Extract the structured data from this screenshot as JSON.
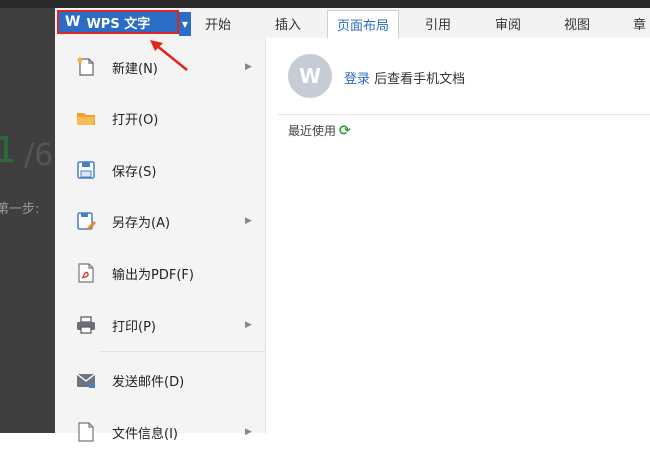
{
  "app_button": {
    "logo": "W",
    "label": "WPS 文字",
    "caret": "▼"
  },
  "tabs": [
    {
      "label": "开始"
    },
    {
      "label": "插入"
    },
    {
      "label": "页面布局"
    },
    {
      "label": "引用"
    },
    {
      "label": "审阅"
    },
    {
      "label": "视图"
    },
    {
      "label": "章"
    }
  ],
  "active_tab": "页面布局",
  "background_doc": {
    "number": "1",
    "slash": "/6",
    "step_text": "第一步:"
  },
  "menu": {
    "items": [
      {
        "label": "新建(N)",
        "icon": "new-document-icon",
        "has_submenu": true
      },
      {
        "label": "打开(O)",
        "icon": "open-folder-icon",
        "has_submenu": false
      },
      {
        "label": "保存(S)",
        "icon": "save-icon",
        "has_submenu": false
      },
      {
        "label": "另存为(A)",
        "icon": "save-as-icon",
        "has_submenu": true
      },
      {
        "label": "输出为PDF(F)",
        "icon": "export-pdf-icon",
        "has_submenu": false
      },
      {
        "label": "打印(P)",
        "icon": "print-icon",
        "has_submenu": true
      },
      {
        "label": "发送邮件(D)",
        "icon": "mail-icon",
        "has_submenu": false
      },
      {
        "label": "文件信息(I)",
        "icon": "file-info-icon",
        "has_submenu": true
      }
    ],
    "submenu_glyph": "▶"
  },
  "panel": {
    "avatar_glyph": "W",
    "login_link": "登录",
    "login_suffix": " 后查看手机文档",
    "recent_label": "最近使用",
    "refresh_glyph": "⟳"
  },
  "colors": {
    "accent": "#2b6cc4",
    "highlight_border": "#e0241f",
    "refresh": "#2aa343"
  }
}
